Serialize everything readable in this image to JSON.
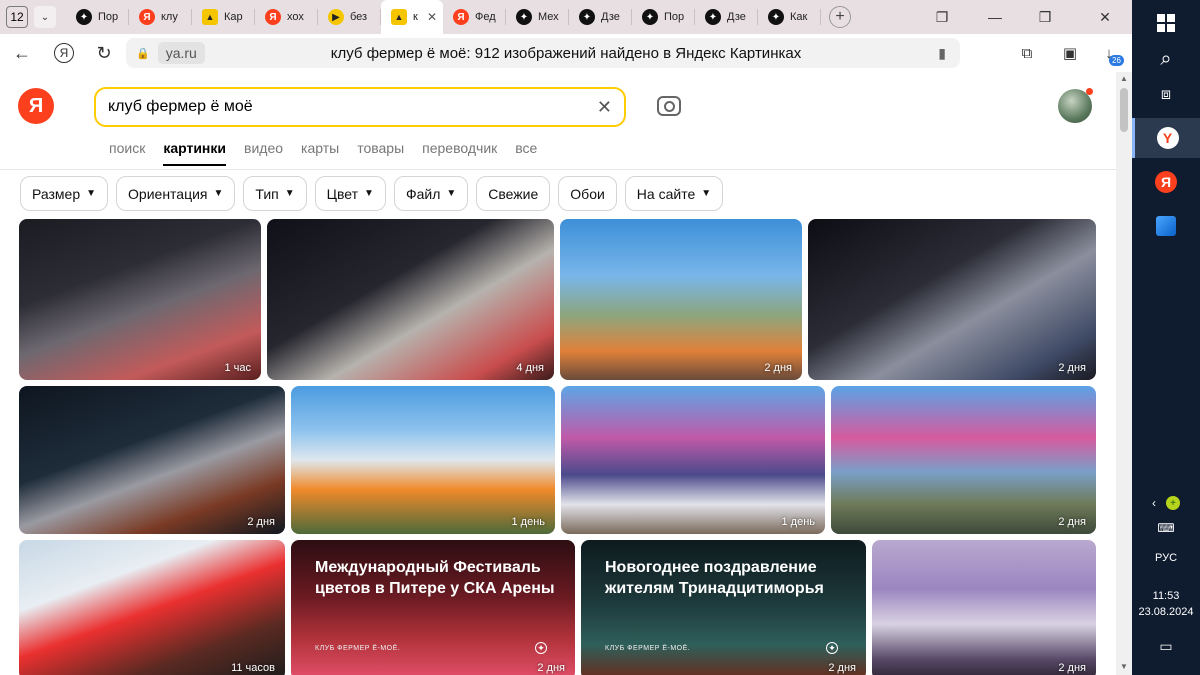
{
  "browser": {
    "tab_count": "12",
    "tabs": [
      {
        "label": "Пор",
        "favicon": "dzen-icon",
        "active": false
      },
      {
        "label": "клу",
        "favicon": "yandex-icon",
        "active": false
      },
      {
        "label": "Кар",
        "favicon": "yandex-images-icon",
        "active": false
      },
      {
        "label": "хох",
        "favicon": "yandex-icon",
        "active": false
      },
      {
        "label": "без",
        "favicon": "yandex-video-icon",
        "active": false
      },
      {
        "label": "к",
        "favicon": "yandex-images-icon",
        "active": true
      },
      {
        "label": "Фед",
        "favicon": "yandex-icon",
        "active": false
      },
      {
        "label": "Мех",
        "favicon": "dzen-icon",
        "active": false
      },
      {
        "label": "Дзе",
        "favicon": "dzen-icon",
        "active": false
      },
      {
        "label": "Пор",
        "favicon": "dzen-icon",
        "active": false
      },
      {
        "label": "Дзе",
        "favicon": "dzen-icon",
        "active": false
      },
      {
        "label": "Как",
        "favicon": "dzen-icon",
        "active": false
      }
    ],
    "domain": "ya.ru",
    "page_title": "клуб фермер ё моё: 912 изображений найдено в Яндекс Картинках",
    "downloads_badge": "26"
  },
  "search": {
    "logo": "Я",
    "query": "клуб фермер ё моё"
  },
  "services": [
    {
      "label": "поиск",
      "active": false
    },
    {
      "label": "картинки",
      "active": true
    },
    {
      "label": "видео",
      "active": false
    },
    {
      "label": "карты",
      "active": false
    },
    {
      "label": "товары",
      "active": false
    },
    {
      "label": "переводчик",
      "active": false
    },
    {
      "label": "все",
      "active": false
    }
  ],
  "filters": [
    {
      "label": "Размер",
      "dropdown": true
    },
    {
      "label": "Ориентация",
      "dropdown": true
    },
    {
      "label": "Тип",
      "dropdown": true
    },
    {
      "label": "Цвет",
      "dropdown": true
    },
    {
      "label": "Файл",
      "dropdown": true
    },
    {
      "label": "Свежие",
      "dropdown": false
    },
    {
      "label": "Обои",
      "dropdown": false
    },
    {
      "label": "На сайте",
      "dropdown": true
    }
  ],
  "images": [
    {
      "age": "1 час"
    },
    {
      "age": "4 дня"
    },
    {
      "age": "2 дня"
    },
    {
      "age": "2 дня"
    },
    {
      "age": "2 дня"
    },
    {
      "age": "1 день"
    },
    {
      "age": "1 день"
    },
    {
      "age": "2 дня"
    },
    {
      "age": "11 часов"
    },
    {
      "age": "2 дня",
      "title": "Международный Фестиваль цветов в Питере у СКА Арены",
      "brand": "КЛУБ ФЕРМЕР Ё-МОЁ."
    },
    {
      "age": "2 дня",
      "title": "Новогоднее поздравление жителям Тринадцитиморья",
      "brand": "КЛУБ ФЕРМЕР Ё-МОЁ."
    },
    {
      "age": "2 дня"
    }
  ],
  "taskbar": {
    "language": "РУС",
    "time": "11:53",
    "date": "23.08.2024"
  }
}
